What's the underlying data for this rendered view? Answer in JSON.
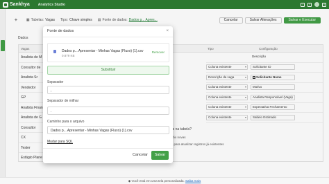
{
  "topbar": {
    "brand": "Sankhya",
    "app_name": "Analytics Studio"
  },
  "toolbar": {
    "table_label": "Tabelas:",
    "table_value": "Vagas",
    "type_label": "Tipo:",
    "type_value": "Chave simples",
    "source_label": "Fonte de dados:",
    "source_value": "Dados p... Apres...",
    "cancel": "Cancelar",
    "save_changes": "Salvar Alterações",
    "save_run": "Salvar e Executar"
  },
  "section_title": "Dados",
  "table": {
    "col_vagas": "Vagas",
    "col_tipo": "Tipo",
    "col_config": "Configuração",
    "left_rows": [
      "Analista de M",
      "Consultor de",
      "Analista Sr",
      "Vendedor",
      "GP",
      "Analista Finan",
      "Analista de G",
      "Consultor",
      "CX",
      "Tester",
      "Estágio Plane"
    ],
    "mid_rows": [
      "",
      "",
      "",
      "",
      "nsável",
      "chamento",
      "",
      ""
    ],
    "right_rows": [
      {
        "sel": "",
        "inp": "Descrição",
        "bold": false,
        "check": false
      },
      {
        "sel": "Coluna existente",
        "inp": "Solicitante ID",
        "bold": false,
        "check": false
      },
      {
        "sel": "Descrição da vaga",
        "inp": "Solicitante Nome",
        "bold": true,
        "check": true
      },
      {
        "sel": "Coluna existente",
        "inp": "Motivo",
        "bold": false,
        "check": false
      },
      {
        "sel": "Coluna existente",
        "inp": "Analista Responsável (Vaga)",
        "bold": false,
        "check": false
      },
      {
        "sel": "Coluna existente",
        "inp": "Expectativa Fechamento",
        "bold": false,
        "check": false
      },
      {
        "sel": "Coluna existente",
        "inp": "Salário Estimado",
        "bold": false,
        "check": false
      }
    ],
    "question": "serão novas na tabela?",
    "radio1": "linhas serão novas",
    "radio2": "descrição para atualizar registros já existentes"
  },
  "modal": {
    "title": "Fonte de dados",
    "file_name": "Dados p... Apresentar - Minhas Vagas (Fluxo) (1).csv",
    "file_size": "0.879 KB",
    "remove": "Remover",
    "replace": "Substituir",
    "separator_label": "Separador",
    "separator_value": ",",
    "thousands_label": "Separador de milhar",
    "thousands_value": ".",
    "path_label": "Caminho para o arquivo",
    "path_value": "Dados p... Apresentar - Minhas Vagas (Fluxo) (1).csv",
    "sql_link": "Mudar para SQL",
    "cancel": "Cancelar",
    "save": "Salvar"
  },
  "bottombar": {
    "text": "Você está em uma tela personalizada.",
    "link": "Saiba mais"
  }
}
